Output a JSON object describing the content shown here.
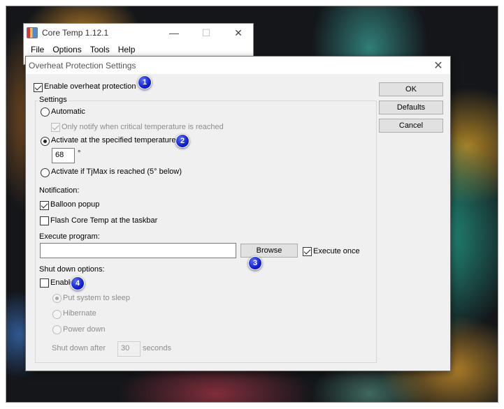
{
  "main_window": {
    "title": "Core Temp 1.12.1",
    "icon": "core-temp-app-icon",
    "controls": {
      "minimize": "—",
      "maximize": "☐",
      "close": "✕"
    },
    "menu": [
      "File",
      "Options",
      "Tools",
      "Help"
    ]
  },
  "dialog": {
    "title": "Overheat Protection Settings",
    "close_glyph": "✕",
    "enable_protection": {
      "label": "Enable overheat protection",
      "checked": true
    },
    "settings_group_label": "Settings",
    "automatic": {
      "label": "Automatic",
      "selected": false
    },
    "only_notify": {
      "label": "Only notify when critical temperature is reached",
      "checked": true
    },
    "activate_specified": {
      "label": "Activate at the specified temperature",
      "selected": true
    },
    "temperature_value": "68",
    "temperature_unit": "°",
    "activate_tjmax": {
      "label": "Activate if TjMax is reached (5° below)",
      "selected": false
    },
    "notification_label": "Notification:",
    "balloon_popup": {
      "label": "Balloon popup",
      "checked": true
    },
    "flash_taskbar": {
      "label": "Flash Core Temp at the taskbar",
      "checked": false
    },
    "execute_program_label": "Execute program:",
    "execute_program_value": "",
    "browse_label": "Browse",
    "execute_once": {
      "label": "Execute once",
      "checked": true
    },
    "shutdown_label": "Shut down options:",
    "shutdown_enable": {
      "label": "Enable",
      "checked": false
    },
    "sleep": {
      "label": "Put system to sleep",
      "selected": true
    },
    "hibernate": {
      "label": "Hibernate",
      "selected": false
    },
    "power_down": {
      "label": "Power down",
      "selected": false
    },
    "shutdown_after_label": "Shut down after",
    "shutdown_after_value": "30",
    "seconds_label": "seconds",
    "buttons": {
      "ok": "OK",
      "defaults": "Defaults",
      "cancel": "Cancel"
    }
  },
  "annotations": [
    "1",
    "2",
    "3",
    "4"
  ],
  "colors": {
    "badge": "#1020d0",
    "dialog_bg": "#f0f0f0",
    "disabled_text": "#8d8d8d"
  }
}
